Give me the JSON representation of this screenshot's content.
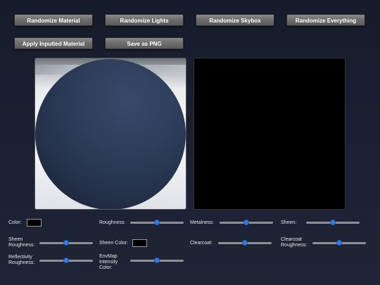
{
  "buttons": {
    "randomize_material": "Randomize Material",
    "randomize_lights": "Randomize Lights",
    "randomize_skybox": "Randomize Skybox",
    "randomize_everything": "Randomize Everything",
    "apply_inputted_material": "Apply Inputted Material",
    "save_png": "Save as PNG"
  },
  "controls": {
    "color": {
      "label": "Color:",
      "value": "#000000"
    },
    "roughness": {
      "label": "Roughness:",
      "value": 0.5
    },
    "metalness": {
      "label": "Metalness:",
      "value": 0.5
    },
    "sheen": {
      "label": "Sheen:",
      "value": 0.5
    },
    "sheen_roughness": {
      "label": "Sheen\nRoughness:",
      "value": 0.5
    },
    "sheen_color": {
      "label": "Sheen Color:",
      "value": "#000000"
    },
    "clearcoat": {
      "label": "Clearcoat:",
      "value": 0.5
    },
    "clearcoat_roughness": {
      "label": "Clearcoat\nRoughness:",
      "value": 0.5
    },
    "reflectivity_roughness": {
      "label": "Reflectivity\nRoughness:",
      "value": 0.5
    },
    "envmap_intensity_color": {
      "label": "EnvMap\nIntensity\nColor:",
      "value": 0.5
    }
  },
  "colors": {
    "accent": "#2f7be8",
    "material_color": "#2e3e5b",
    "skybox_background": "#000000"
  }
}
